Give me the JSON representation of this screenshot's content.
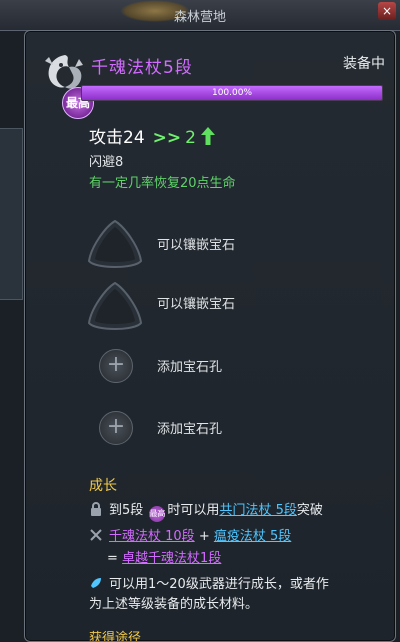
{
  "scene": {
    "area_title": "森林营地"
  },
  "item": {
    "name": "千魂法杖5段",
    "rank_badge": "最高",
    "equip_status": "装备中",
    "progress": 1.0,
    "progress_text": "100.00%"
  },
  "stats": {
    "attack_label": "攻击24",
    "arrow": ">>",
    "attack_new": "2",
    "dodge": "闪避8",
    "effect": "有一定几率恢复20点生命"
  },
  "sockets": [
    {
      "label": "可以镶嵌宝石"
    },
    {
      "label": "可以镶嵌宝石"
    },
    {
      "label": "添加宝石孔"
    },
    {
      "label": "添加宝石孔"
    }
  ],
  "growth": {
    "title": "成长",
    "line1_prefix": "到5段",
    "line1_middle": "时可以用",
    "line1_link": "共门法杖 5段",
    "line1_suffix": "突破",
    "line2_link1": "千魂法杖 10段",
    "line2_plus": "+",
    "line2_link2": "瘟疫法杖 5段",
    "line3_eq": "=",
    "line3_link": "卓越千魂法杖1段",
    "line4": "可以用1～20级武器进行成长，或者作",
    "line5": "为上述等级装备的成长材料。"
  },
  "source": {
    "title": "获得途径"
  },
  "colors": {
    "purple": "#d26bff",
    "green": "#5fd36a",
    "gold": "#f0c94a",
    "link_blue": "#4fc6ff"
  },
  "icons": [
    "dragon-emblem-icon",
    "up-arrow-icon",
    "socket-triangle-icon",
    "plus-icon",
    "lock-icon",
    "combine-icon",
    "material-icon"
  ]
}
